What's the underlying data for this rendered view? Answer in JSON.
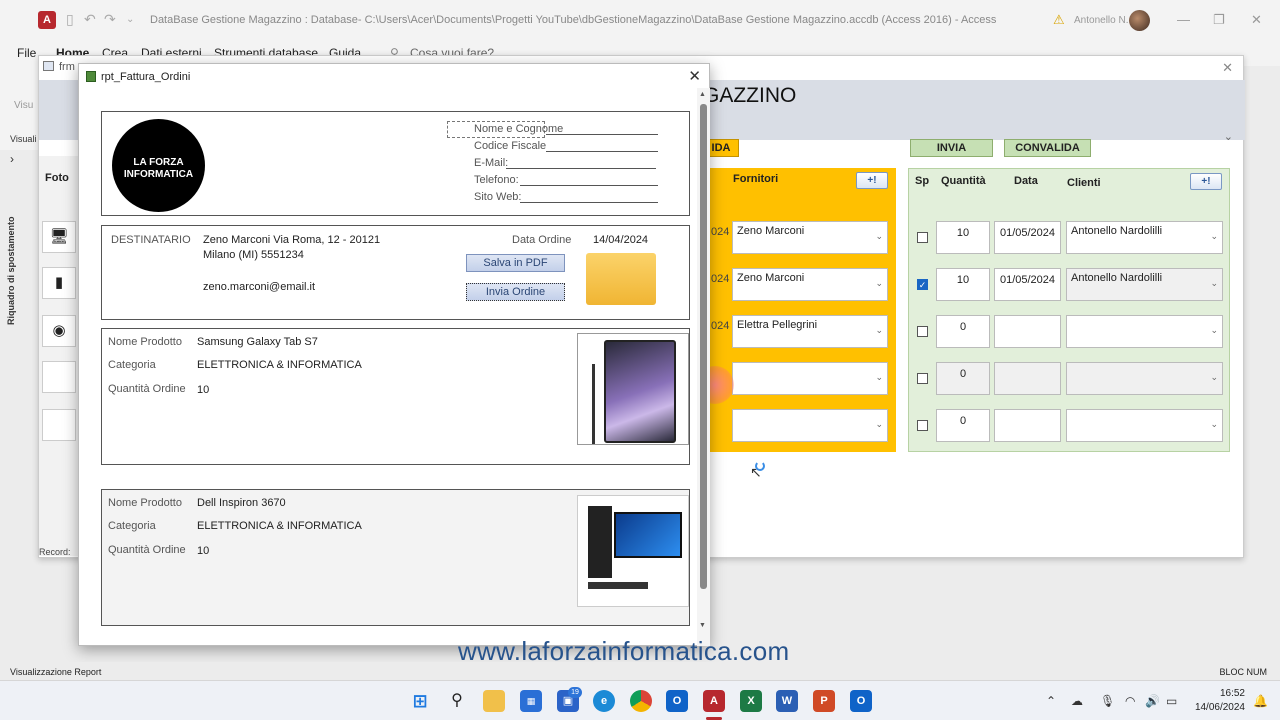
{
  "titlebar": {
    "title": "DataBase Gestione Magazzino : Database- C:\\Users\\Acer\\Documents\\Progetti YouTube\\dbGestioneMagazzino\\DataBase Gestione Magazzino.accdb (Access 2016)  -  Access",
    "user": "Antonello N.",
    "app_icon": "A"
  },
  "ribbon": {
    "menus": [
      "File",
      "Home",
      "Crea",
      "Dati esterni",
      "Strumenti database",
      "Guida"
    ],
    "search": "Cosa vuoi fare?",
    "visual_label": "Visuali",
    "vis_label": "Visu"
  },
  "navpane": {
    "title": "Riquadro di spostamento"
  },
  "form": {
    "tab_title": "frm",
    "header_title": "GAZZINO",
    "foto_header": "Foto",
    "record_label": "Record:",
    "yellow_button": "IDA",
    "green_buttons": [
      "INVIA",
      "CONVALIDA"
    ],
    "fornitori_header": "Fornitori",
    "plus_label": "+!",
    "green_headers": [
      "Sp",
      "Quantità",
      "Data",
      "Clienti"
    ],
    "rows": [
      {
        "year": "024",
        "fornitore": "Zeno Marconi",
        "checked": false,
        "qty": "10",
        "date": "01/05/2024",
        "cliente": "Antonello Nardolilli"
      },
      {
        "year": "024",
        "fornitore": "Zeno Marconi",
        "checked": true,
        "qty": "10",
        "date": "01/05/2024",
        "cliente": "Antonello Nardolilli"
      },
      {
        "year": "024",
        "fornitore": "Elettra Pellegrini",
        "checked": false,
        "qty": "0",
        "date": "",
        "cliente": ""
      },
      {
        "year": "",
        "fornitore": "",
        "checked": false,
        "qty": "0",
        "date": "",
        "cliente": ""
      },
      {
        "year": "",
        "fornitore": "",
        "checked": false,
        "qty": "0",
        "date": "",
        "cliente": ""
      }
    ]
  },
  "report": {
    "title": "rpt_Fattura_Ordini",
    "logo_text": "LA FORZA INFORMATICA",
    "fields": [
      "Nome e Cognome",
      "Codice Fiscale",
      "E-Mail:",
      "Telefono:",
      "Sito Web:"
    ],
    "destinatario_label": "DESTINATARIO",
    "address1": "Zeno Marconi Via Roma, 12 - 20121",
    "address2": "Milano (MI) 5551234",
    "email": "zeno.marconi@email.it",
    "data_ordine_label": "Data Ordine",
    "data_ordine": "14/04/2024",
    "btn_pdf": "Salva in PDF",
    "btn_invia": "Invia Ordine",
    "products": [
      {
        "nome_label": "Nome Prodotto",
        "nome": "Samsung Galaxy Tab S7",
        "cat_label": "Categoria",
        "cat": "ELETTRONICA & INFORMATICA",
        "qty_label": "Quantità Ordine",
        "qty": "10"
      },
      {
        "nome_label": "Nome Prodotto",
        "nome": "Dell Inspiron 3670",
        "cat_label": "Categoria",
        "cat": "ELETTRONICA & INFORMATICA",
        "qty_label": "Quantità Ordine",
        "qty": "10"
      }
    ]
  },
  "status": {
    "left": "Visualizzazione Report",
    "right": "BLOC NUM"
  },
  "watermark": "www.laforzainformatica.com",
  "taskbar": {
    "badge": "19",
    "time": "16:52",
    "date": "14/06/2024"
  },
  "colors": {
    "yellow": "#ffc000",
    "green": "#e2efda",
    "access_red": "#b7282e"
  }
}
